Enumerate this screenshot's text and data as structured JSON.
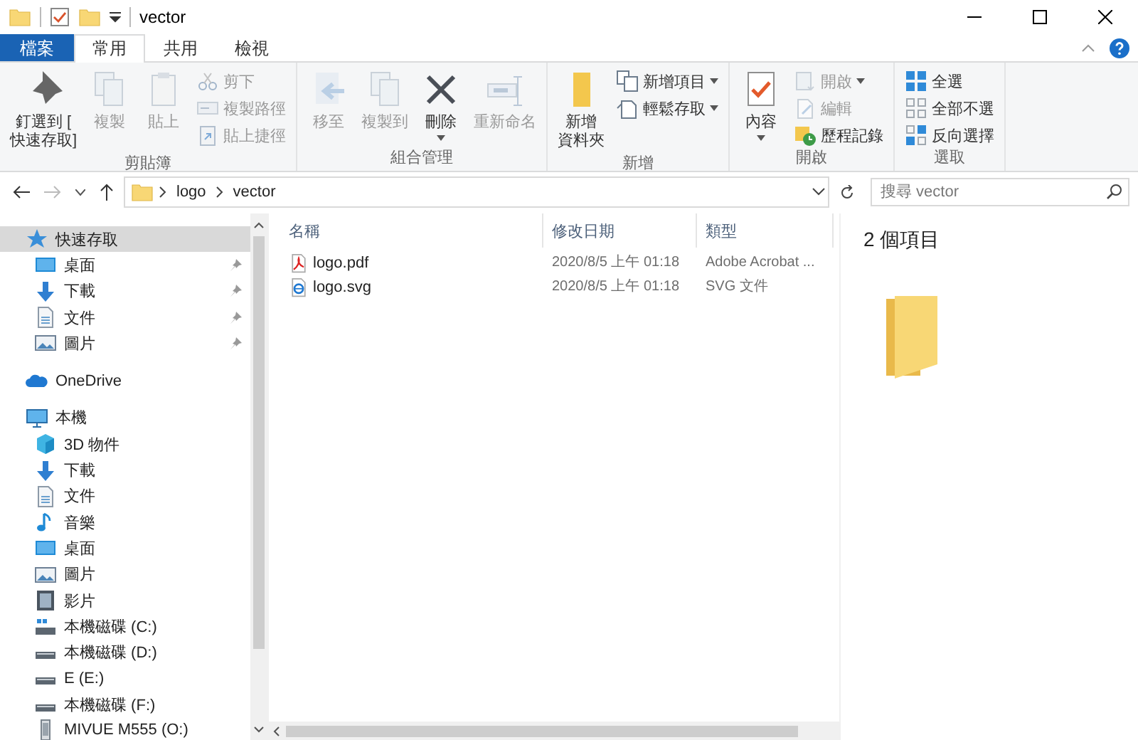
{
  "window": {
    "title": "vector"
  },
  "ribbon_tabs": [
    {
      "label": "檔案",
      "selected": false,
      "kind": "file"
    },
    {
      "label": "常用",
      "selected": true,
      "kind": "tab"
    },
    {
      "label": "共用",
      "selected": false,
      "kind": "tab"
    },
    {
      "label": "檢視",
      "selected": false,
      "kind": "tab"
    }
  ],
  "ribbon_groups": [
    {
      "title": "剪貼簿",
      "items": [
        {
          "label": "釘選到 [\n快速存取]",
          "kind": "large",
          "disabled": false,
          "dropdown": false
        },
        {
          "label": "複製",
          "kind": "large",
          "disabled": true,
          "dropdown": false
        },
        {
          "label": "貼上",
          "kind": "large",
          "disabled": true,
          "dropdown": false
        },
        {
          "kind": "stack",
          "children": [
            {
              "label": "剪下",
              "disabled": true,
              "dropdown": false
            },
            {
              "label": "複製路徑",
              "disabled": true,
              "dropdown": false
            },
            {
              "label": "貼上捷徑",
              "disabled": true,
              "dropdown": false
            }
          ]
        }
      ]
    },
    {
      "title": "組合管理",
      "items": [
        {
          "label": "移至",
          "kind": "large",
          "disabled": true,
          "dropdown": false
        },
        {
          "label": "複製到",
          "kind": "large",
          "disabled": true,
          "dropdown": false
        },
        {
          "label": "刪除",
          "kind": "large",
          "disabled": false,
          "dropdown": true
        },
        {
          "label": "重新命名",
          "kind": "large",
          "disabled": true,
          "dropdown": false
        }
      ]
    },
    {
      "title": "新增",
      "items": [
        {
          "label": [
            "新增",
            "資料夾"
          ],
          "kind": "large",
          "disabled": false,
          "dropdown": false
        },
        {
          "kind": "stack",
          "children": [
            {
              "label": "新增項目",
              "disabled": false,
              "dropdown": true
            },
            {
              "label": "輕鬆存取",
              "disabled": false,
              "dropdown": true
            }
          ]
        }
      ]
    },
    {
      "title": "開啟",
      "items": [
        {
          "label": "內容",
          "kind": "large",
          "disabled": false,
          "dropdown": true
        },
        {
          "kind": "stack",
          "children": [
            {
              "label": "開啟",
              "disabled": true,
              "dropdown": true
            },
            {
              "label": "編輯",
              "disabled": true,
              "dropdown": false
            },
            {
              "label": "歷程記錄",
              "disabled": false,
              "dropdown": false
            }
          ]
        }
      ]
    },
    {
      "title": "選取",
      "items": [
        {
          "kind": "stack",
          "children": [
            {
              "label": "全選",
              "disabled": false,
              "dropdown": false
            },
            {
              "label": "全部不選",
              "disabled": false,
              "dropdown": false
            },
            {
              "label": "反向選擇",
              "disabled": false,
              "dropdown": false
            }
          ]
        }
      ]
    }
  ],
  "address_bar": {
    "path": [
      "logo",
      "vector"
    ],
    "search_placeholder": "搜尋 vector"
  },
  "sidebar": {
    "items": [
      {
        "label": "快速存取",
        "kind": "star",
        "selected": true,
        "children": [
          {
            "label": "桌面",
            "kind": "desktop",
            "selected": false,
            "pinned": true
          },
          {
            "label": "下載",
            "kind": "download",
            "selected": false,
            "pinned": true
          },
          {
            "label": "文件",
            "kind": "document",
            "selected": false,
            "pinned": true
          },
          {
            "label": "圖片",
            "kind": "pictures",
            "selected": false,
            "pinned": true
          }
        ]
      },
      {
        "label": "OneDrive",
        "kind": "cloud",
        "selected": false
      },
      {
        "label": "本機",
        "kind": "pc",
        "selected": false,
        "children": [
          {
            "label": "3D 物件",
            "kind": "cube",
            "selected": false,
            "pinned": false
          },
          {
            "label": "下載",
            "kind": "download",
            "selected": false,
            "pinned": false
          },
          {
            "label": "文件",
            "kind": "document",
            "selected": false,
            "pinned": false
          },
          {
            "label": "音樂",
            "kind": "music",
            "selected": false,
            "pinned": false
          },
          {
            "label": "桌面",
            "kind": "desktop",
            "selected": false,
            "pinned": false
          },
          {
            "label": "圖片",
            "kind": "pictures",
            "selected": false,
            "pinned": false
          },
          {
            "label": "影片",
            "kind": "video",
            "selected": false,
            "pinned": false
          },
          {
            "label": "本機磁碟 (C:)",
            "kind": "sysdrive",
            "selected": false,
            "pinned": false
          },
          {
            "label": "本機磁碟 (D:)",
            "kind": "drive",
            "selected": false,
            "pinned": false
          },
          {
            "label": "E (E:)",
            "kind": "drive",
            "selected": false,
            "pinned": false
          },
          {
            "label": "本機磁碟 (F:)",
            "kind": "drive",
            "selected": false,
            "pinned": false
          },
          {
            "label": "MIVUE M555 (O:)",
            "kind": "usb",
            "selected": false,
            "pinned": false
          }
        ]
      }
    ]
  },
  "file_list": {
    "columns": [
      "名稱",
      "修改日期",
      "類型"
    ],
    "rows": [
      {
        "name": "logo.pdf",
        "modified": "2020/8/5 上午 01:18",
        "type": "Adobe Acrobat ...",
        "kind": "pdf",
        "selected": false
      },
      {
        "name": "logo.svg",
        "modified": "2020/8/5 上午 01:18",
        "type": "SVG 文件",
        "kind": "svg",
        "selected": false
      }
    ]
  },
  "preview": {
    "count": "2 個項目"
  }
}
